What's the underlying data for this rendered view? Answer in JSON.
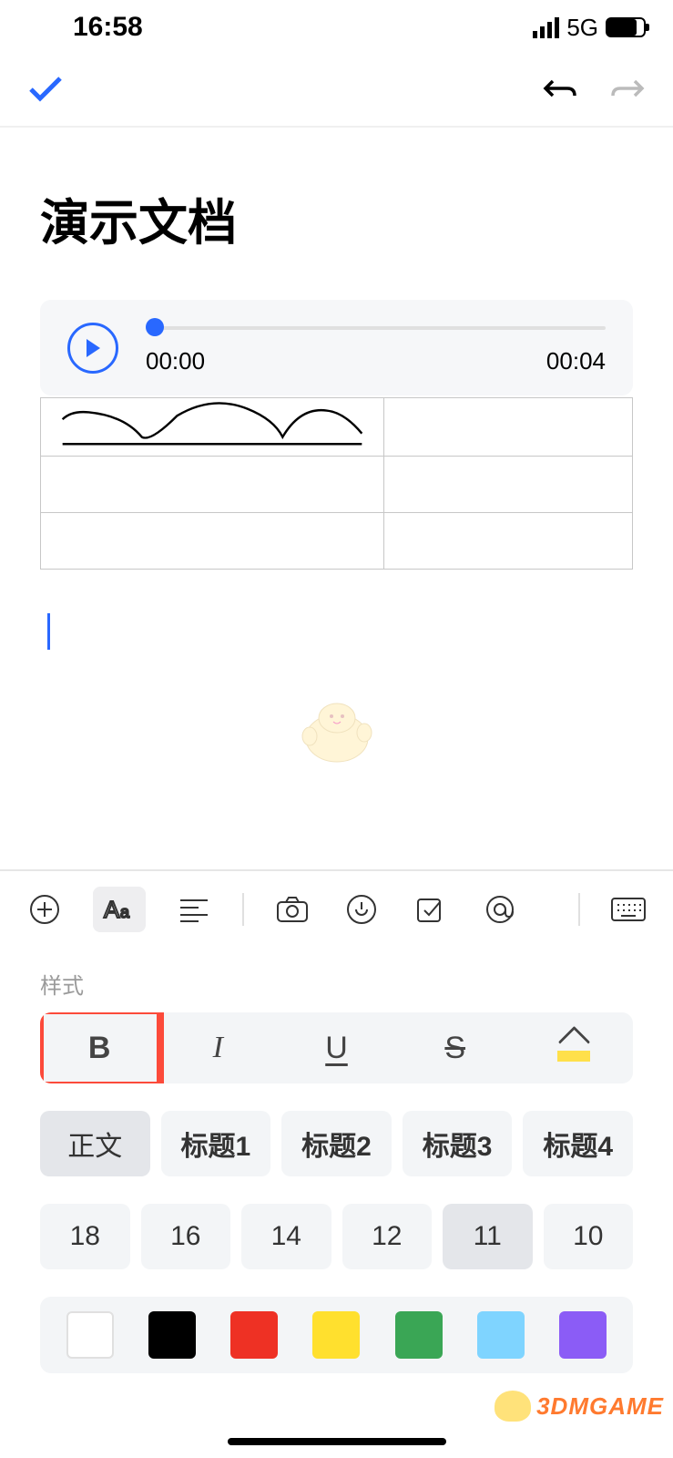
{
  "status": {
    "time": "16:58",
    "network": "5G"
  },
  "document": {
    "title": "演示文档"
  },
  "audio": {
    "current": "00:00",
    "duration": "00:04"
  },
  "panel": {
    "label": "样式",
    "styleButtons": {
      "bold": "B",
      "italic": "I",
      "underline": "U",
      "strike": "S"
    },
    "headings": [
      "正文",
      "标题1",
      "标题2",
      "标题3",
      "标题4"
    ],
    "activeHeading": 0,
    "sizes": [
      "18",
      "16",
      "14",
      "12",
      "11",
      "10"
    ],
    "activeSize": 4,
    "colors": [
      "#ffffff",
      "#000000",
      "#ee3124",
      "#ffe02e",
      "#3aa655",
      "#7fd4ff",
      "#8b5cf6"
    ]
  },
  "watermark": "3DMGAME"
}
